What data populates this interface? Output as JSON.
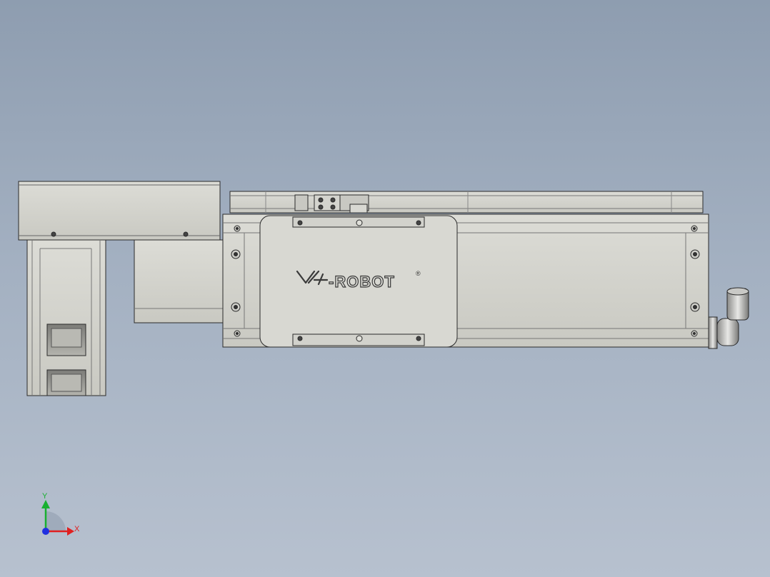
{
  "model": {
    "logo_text": "-ROBOT",
    "logo_mark": "®"
  },
  "triad": {
    "x_label": "X",
    "y_label": "Y",
    "x_color": "#e02020",
    "y_color": "#18b030",
    "z_color": "#2030e0"
  },
  "colors": {
    "background_top": "#8e9db0",
    "background_bottom": "#b7c1cf",
    "part_fill": "#d6d6d0",
    "part_shade": "#bdbdb6",
    "edge": "#2a2a2a"
  }
}
